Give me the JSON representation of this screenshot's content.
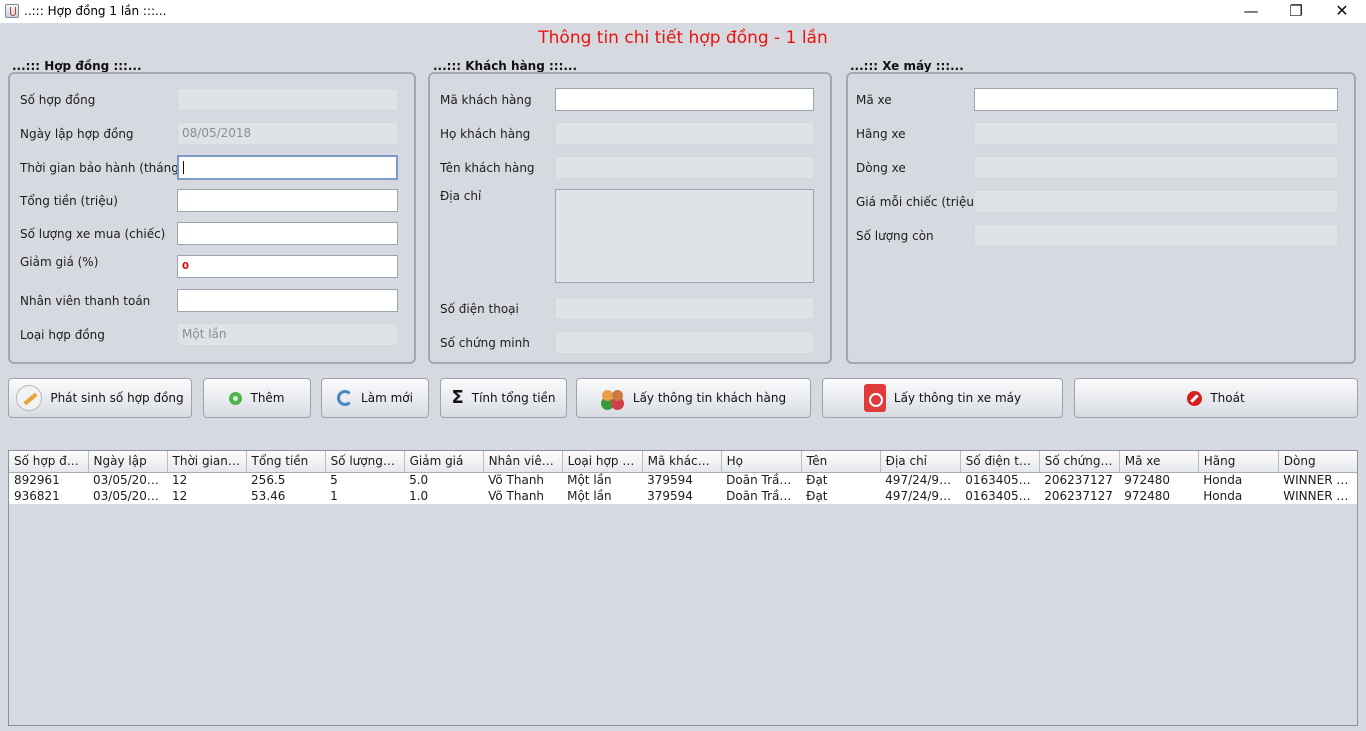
{
  "window": {
    "title": "..::: Hợp đồng 1 lần :::...",
    "minimize": "—",
    "maximize": "❐",
    "close": "✕",
    "icon": "java-icon"
  },
  "page_title": "Thông tin chi tiết hợp đồng - 1 lần",
  "contract": {
    "group_label": "...::: Hợp đồng :::...",
    "so_hop_dong_label": "Số hợp đồng",
    "so_hop_dong_value": "",
    "ngay_lap_label": "Ngày lập hợp đồng",
    "ngay_lap_value": "08/05/2018",
    "bao_hanh_label": "Thời gian bảo hành (tháng)",
    "bao_hanh_value": "",
    "tong_tien_label": "Tổng tiền (triệu)",
    "tong_tien_value": "",
    "so_luong_label": "Số lượng xe mua (chiếc)",
    "so_luong_value": "",
    "giam_gia_label": "Giảm giá (%)",
    "giam_gia_value": "0",
    "nhan_vien_label": "Nhân viên thanh toán",
    "nhan_vien_value": "",
    "loai_label": "Loại hợp đồng",
    "loai_value": "Một lần"
  },
  "customer": {
    "group_label": "...::: Khách hàng :::...",
    "ma_label": "Mã khách hàng",
    "ma_value": "",
    "ho_label": "Họ khách hàng",
    "ho_value": "",
    "ten_label": "Tên khách hàng",
    "ten_value": "",
    "dia_chi_label": "Địa chỉ",
    "dia_chi_value": "",
    "sdt_label": "Số điện thoại",
    "sdt_value": "",
    "cmnd_label": "Số chứng minh",
    "cmnd_value": ""
  },
  "motorbike": {
    "group_label": "...::: Xe máy :::...",
    "ma_label": "Mã xe",
    "ma_value": "",
    "hang_label": "Hãng xe",
    "hang_value": "",
    "dong_label": "Dòng xe",
    "dong_value": "",
    "gia_label": "Giá mỗi chiếc (triệu)",
    "gia_value": "",
    "con_label": "Số lượng còn",
    "con_value": ""
  },
  "buttons": {
    "generate": "Phát sinh số hợp đồng",
    "add": "Thêm",
    "refresh": "Làm mới",
    "total": "Tính tổng tiền",
    "get_customer": "Lấy thông tin khách hàng",
    "get_bike": "Lấy thông tin xe máy",
    "exit": "Thoát"
  },
  "table": {
    "headers": [
      "Số hợp đồ...",
      "Ngày lập",
      "Thời gian ...",
      "Tổng tiền",
      "Số lượng x...",
      "Giảm giá",
      "Nhân viên ...",
      "Loại hợp đ...",
      "Mã khách ...",
      "Họ",
      "Tên",
      "Địa chỉ",
      "Số điện th...",
      "Số chứng ...",
      "Mã xe",
      "Hãng",
      "Dòng"
    ],
    "rows": [
      [
        "892961",
        "03/05/2018",
        "12",
        "256.5",
        "5",
        "5.0",
        "Võ Thanh",
        "Một lần",
        "379594",
        "Doãn Trần ...",
        "Đạt",
        "497/24/9N ...",
        "01634054...",
        "206237127",
        "972480",
        "Honda",
        "WINNER 1..."
      ],
      [
        "936821",
        "03/05/2018",
        "12",
        "53.46",
        "1",
        "1.0",
        "Võ Thanh",
        "Một lần",
        "379594",
        "Doãn Trần ...",
        "Đạt",
        "497/24/9N ...",
        "01634054...",
        "206237127",
        "972480",
        "Honda",
        "WINNER 1..."
      ]
    ]
  }
}
